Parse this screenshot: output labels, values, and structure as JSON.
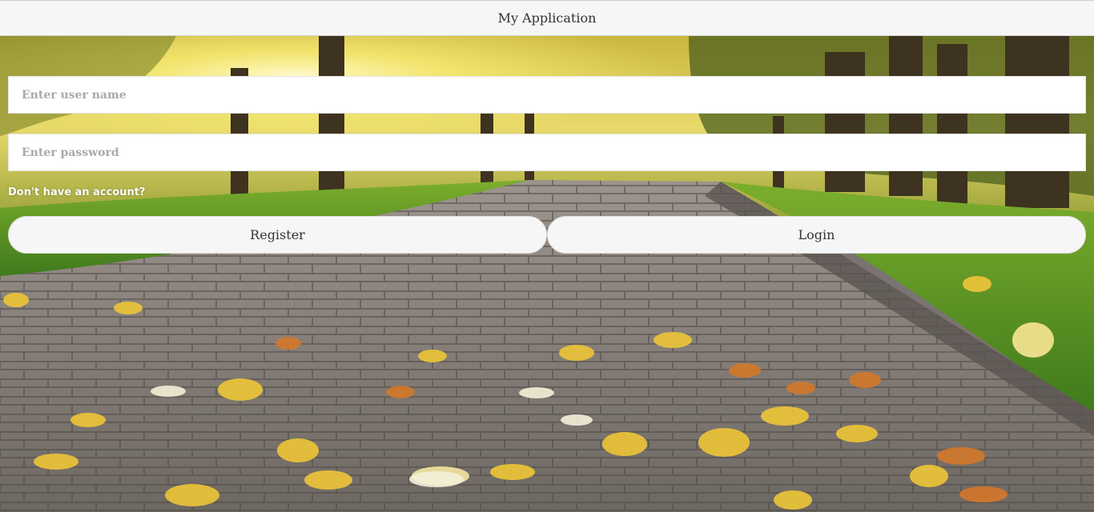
{
  "header": {
    "title": "My Application"
  },
  "form": {
    "username": {
      "placeholder": "Enter user name",
      "value": ""
    },
    "password": {
      "placeholder": "Enter password",
      "value": ""
    },
    "account_prompt": "Don't have an account?",
    "register_label": "Register",
    "login_label": "Login"
  },
  "background": {
    "description_icon": "autumn-park-path-image"
  }
}
